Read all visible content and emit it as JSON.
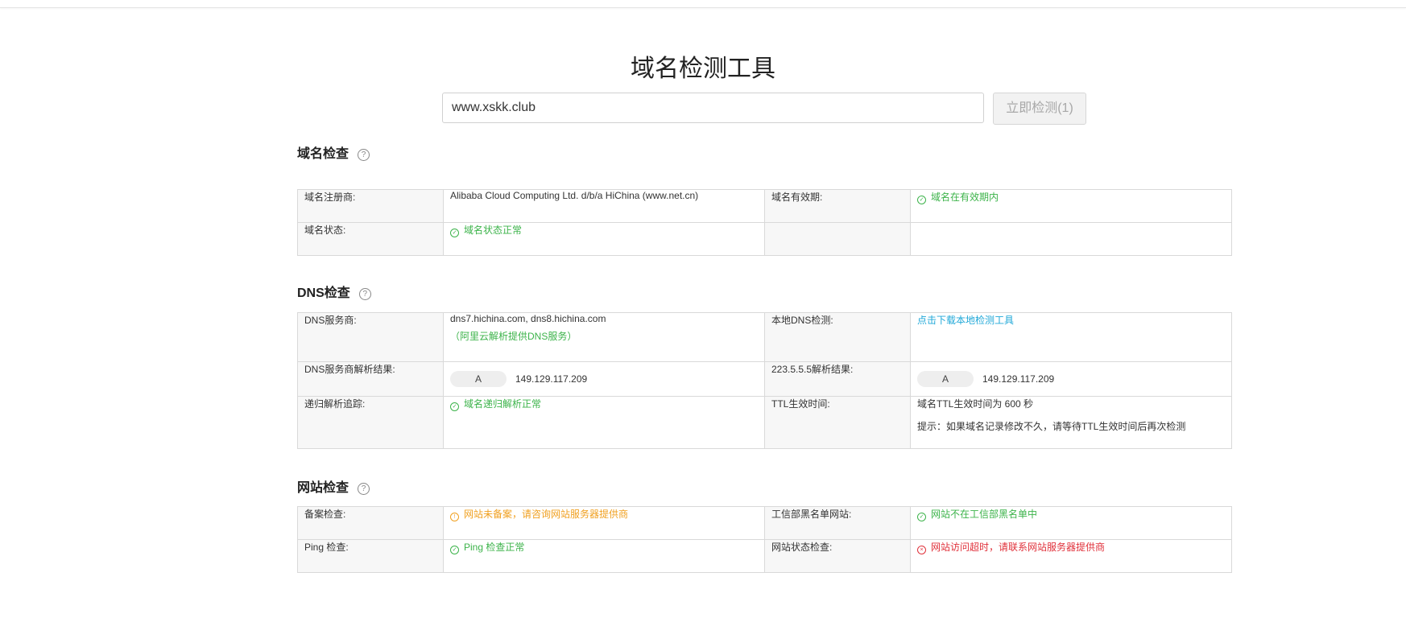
{
  "page": {
    "title": "域名检测工具"
  },
  "search": {
    "value": "www.xskk.club",
    "button_label": "立即检测(1)"
  },
  "sections": {
    "domain": {
      "title": "域名检查",
      "registrar_label": "域名注册商:",
      "registrar_value": "Alibaba Cloud Computing Ltd. d/b/a HiChina (www.net.cn)",
      "validity_label": "域名有效期:",
      "validity_value": "域名在有效期内",
      "status_label": "域名状态:",
      "status_value": "域名状态正常"
    },
    "dns": {
      "title": "DNS检查",
      "provider_label": "DNS服务商:",
      "provider_value": "dns7.hichina.com, dns8.hichina.com",
      "provider_note": "（阿里云解析提供DNS服务）",
      "local_label": "本地DNS检测:",
      "local_link": "点击下载本地检测工具",
      "provider_result_label": "DNS服务商解析结果:",
      "provider_result_type": "A",
      "provider_result_ip": "149.129.117.209",
      "public_result_label": "223.5.5.5解析结果:",
      "public_result_type": "A",
      "public_result_ip": "149.129.117.209",
      "recursive_label": "递归解析追踪:",
      "recursive_value": "域名递归解析正常",
      "ttl_label": "TTL生效时间:",
      "ttl_value": "域名TTL生效时间为 600 秒",
      "ttl_hint": "提示：如果域名记录修改不久，请等待TTL生效时间后再次检测"
    },
    "website": {
      "title": "网站检查",
      "icp_label": "备案检查:",
      "icp_value": "网站未备案，请咨询网站服务器提供商",
      "blacklist_label": "工信部黑名单网站:",
      "blacklist_value": "网站不在工信部黑名单中",
      "ping_label": "Ping 检查:",
      "ping_value": "Ping 检查正常",
      "status_label": "网站状态检查:",
      "status_value": "网站访问超时，请联系网站服务器提供商"
    }
  },
  "colors": {
    "ok": "#3cb34a",
    "warn": "#f0a020",
    "error": "#e0303a",
    "link": "#20a8d8"
  },
  "icons": {
    "ok": "check-circle-icon",
    "warn": "warning-circle-icon",
    "error": "close-circle-icon",
    "help": "question-circle-icon"
  }
}
